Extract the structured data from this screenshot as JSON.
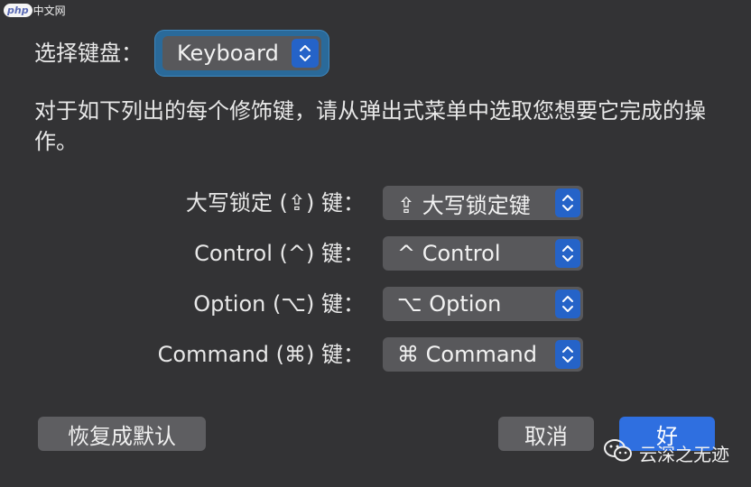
{
  "watermark_top": {
    "brand": "php",
    "site": "中文网"
  },
  "keyboard": {
    "label": "选择键盘：",
    "selected": "Keyboard"
  },
  "description": "对于如下列出的每个修饰键，请从弹出式菜单中选取您想要它完成的操作。",
  "modifiers": [
    {
      "label": "大写锁定 (⇪) 键：",
      "value": "⇪ 大写锁定键"
    },
    {
      "label": "Control (^) 键：",
      "value": "^ Control"
    },
    {
      "label": "Option (⌥) 键：",
      "value": "⌥ Option"
    },
    {
      "label": "Command (⌘) 键：",
      "value": "⌘ Command"
    }
  ],
  "buttons": {
    "restore_defaults": "恢复成默认",
    "cancel": "取消",
    "ok": "好"
  },
  "watermark_bottom": {
    "text": "云深之无迹",
    "icon": "wechat-icon"
  },
  "colors": {
    "accent": "#2563c8",
    "focus_ring": "#2a6a9a",
    "background": "#333335",
    "popup": "#58585b",
    "primary_button": "#2f6fe0"
  }
}
